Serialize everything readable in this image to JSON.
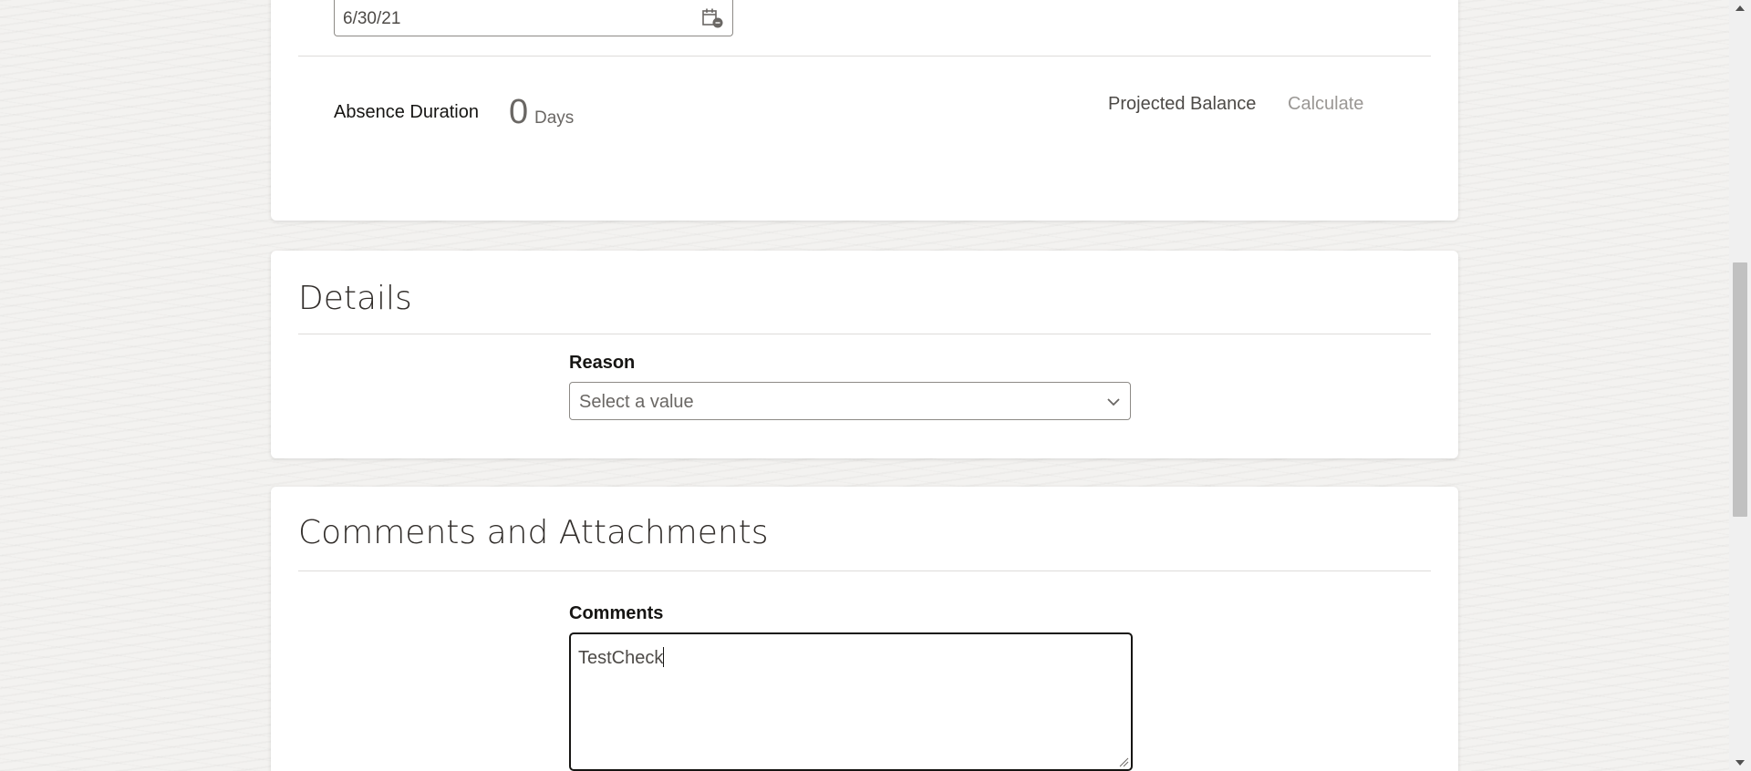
{
  "absence": {
    "end_date_value": "6/30/21",
    "duration_label": "Absence Duration",
    "duration_value": "0",
    "duration_unit": "Days",
    "projected_balance_label": "Projected Balance",
    "calculate_label": "Calculate"
  },
  "details": {
    "title": "Details",
    "reason_label": "Reason",
    "reason_placeholder": "Select a value"
  },
  "comments": {
    "title": "Comments and Attachments",
    "comments_label": "Comments",
    "comments_value": "TestCheck"
  },
  "icons": {
    "date": "calendar-icon",
    "select": "chevron-down-icon",
    "resize": "resize-handle-icon"
  }
}
